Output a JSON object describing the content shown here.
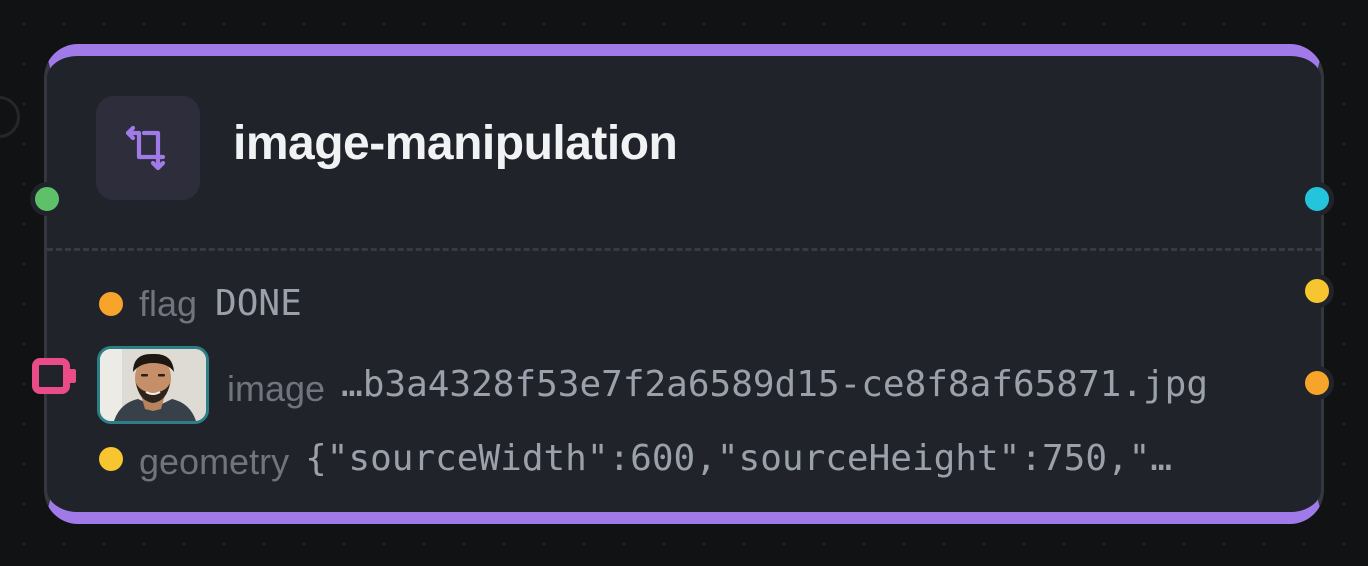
{
  "node": {
    "title": "image-manipulation",
    "icon": "crop-icon",
    "accent_color": "#9f7ae8",
    "fields": {
      "flag": {
        "label": "flag",
        "value": "DONE",
        "dot_color": "#f7a52a"
      },
      "image": {
        "label": "image",
        "value": "…b3a4328f53e7f2a6589d15-ce8f8af65871.jpg",
        "thumbnail": "portrait-thumbnail"
      },
      "geometry": {
        "label": "geometry",
        "value": "{\"sourceWidth\":600,\"sourceHeight\":750,\"…",
        "dot_color": "#f7c52f"
      }
    },
    "ports": {
      "input_main_color": "#5fc06a",
      "output_main_color": "#23c4dc",
      "output_flag_color": "#f7c52f",
      "output_image_color": "#f7a52a",
      "input_image_color": "#ea4c88"
    }
  }
}
